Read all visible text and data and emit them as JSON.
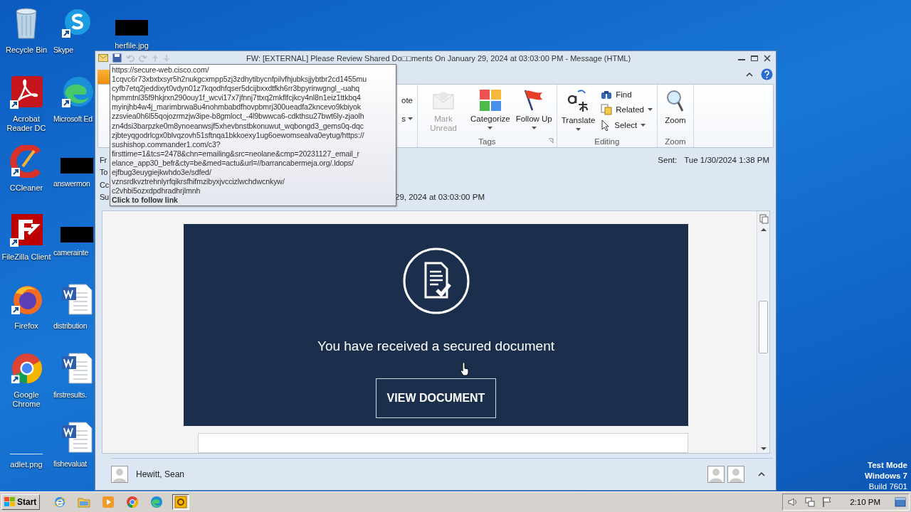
{
  "desktop": {
    "columns": [
      [
        {
          "label": "Recycle Bin",
          "kind": "recycle"
        },
        {
          "label": "Acrobat Reader DC",
          "kind": "acrobat"
        },
        {
          "label": "CCleaner",
          "kind": "ccleaner"
        },
        {
          "label": "FileZilla Client",
          "kind": "filezilla"
        },
        {
          "label": "Firefox",
          "kind": "firefox"
        },
        {
          "label": "Google Chrome",
          "kind": "chrome"
        },
        {
          "label": "adlet.png",
          "kind": "blank"
        }
      ],
      [
        {
          "label": "Skype",
          "kind": "skype"
        },
        {
          "label": "Microsoft Ed",
          "kind": "edge"
        },
        {
          "label": "answermon",
          "kind": "redacted"
        },
        {
          "label": "camerainte",
          "kind": "redacted"
        },
        {
          "label": "distribution",
          "kind": "word"
        },
        {
          "label": "firstresults.",
          "kind": "word"
        },
        {
          "label": "fishevaluat",
          "kind": "word"
        }
      ],
      [
        {
          "label": "herfile.jpg",
          "kind": "redacted"
        }
      ]
    ]
  },
  "window": {
    "title": "FW: [EXTERNAL] Please Review Shared Do□□ments  On January 29, 2024 at 03:03:00 PM  -  Message (HTML)",
    "ribbon": {
      "fragments": [
        "ote",
        "s"
      ],
      "groups": [
        {
          "label": "Tags",
          "buttons": [
            {
              "label": "Mark Unread",
              "kind": "mark-unread",
              "disabled": true,
              "dropdown": false
            },
            {
              "label": "Categorize",
              "kind": "categorize",
              "disabled": false,
              "dropdown": true
            },
            {
              "label": "Follow Up",
              "kind": "follow-up",
              "disabled": false,
              "dropdown": true
            }
          ]
        },
        {
          "label": "Editing",
          "buttons": [
            {
              "label": "Translate",
              "kind": "translate",
              "disabled": false,
              "dropdown": true
            }
          ],
          "small_buttons": [
            {
              "label": "Find",
              "kind": "find",
              "dropdown": false
            },
            {
              "label": "Related",
              "kind": "related",
              "dropdown": true
            },
            {
              "label": "Select",
              "kind": "select",
              "dropdown": true
            }
          ]
        },
        {
          "label": "Zoom",
          "buttons": [
            {
              "label": "Zoom",
              "kind": "zoom",
              "disabled": false,
              "dropdown": false
            }
          ]
        }
      ]
    },
    "header": {
      "field_labels": [
        "Fr",
        "To",
        "Cc",
        "Su"
      ],
      "sent_label": "Sent:",
      "sent_value": "Tue 1/30/2024 1:38 PM",
      "subject_visible": "29, 2024 at 03:03:00 PM"
    },
    "tooltip": {
      "url_lines": [
        "https://secure-web.cisco.com/",
        "1cqvc6r73xbxtxsyr5h2nukgcxmpp5zj3zdhytibycnfpilvfhjubksjjybtbr2cd1455mu",
        "cyfb7etq2jeddixyt0vdyn01z7kqodhfqser5dcijbxxdtfkh6rr3bpyrinwgngl_-uahq",
        "hpmmtnl35f9hkjrxn290ouy1f_wcvi17x7jfnnj7ttxq2mkflfcjkcy4nl8n1eiz1ttkbq4",
        "myinjhb4w4j_marimbrwa8u4nohmbabdfhovpbmrj300ueadfa2kncevo9kbiyok",
        "zzsviea0h6l55qojozrmzjw3ipe-b8gmloct_-4l9bwwca6-cdkthsu27bwt6ly-zjaolh",
        "zn4dsi3barpzke0m8ynoeanwsjf5xhevbnstbkonuwut_wqbongd3_gems0q-dqc",
        "zjbteyqgodrlcgx0blvqzovh51sftnqa1bkkoexy1ug6oewomsealva0eytug/https://",
        "sushishop.commander1.com/c3?",
        "firsttime=1&tcs=2478&chn=emailing&src=neolane&cmp=20231127_email_r",
        "elance_app30_befr&cty=be&med=actu&url=//barrancabermeja.org/.ldops/",
        "ejfbug3euygiejkwhdo3e/sdfed/",
        "vznsrdkvztrehnlyrfqikrsfhifmzibyxjvccizlwchdwcnkyw/",
        "c2vhbi5ozxdpdhradhrjlmnh"
      ],
      "action": "Click to follow link"
    },
    "body": {
      "heading": "You have received a secured document",
      "button": "VIEW DOCUMENT"
    },
    "people_pane": {
      "name": "Hewitt, Sean"
    }
  },
  "taskbar": {
    "start": "Start",
    "apps": [
      {
        "kind": "ie",
        "selected": false
      },
      {
        "kind": "explorer",
        "selected": false
      },
      {
        "kind": "media",
        "selected": false
      },
      {
        "kind": "chrome",
        "selected": false
      },
      {
        "kind": "edge",
        "selected": false
      },
      {
        "kind": "outlook",
        "selected": true
      }
    ],
    "clock": "2:10 PM"
  },
  "os_notice": [
    "Test Mode",
    "Windows 7",
    "Build 7601"
  ]
}
